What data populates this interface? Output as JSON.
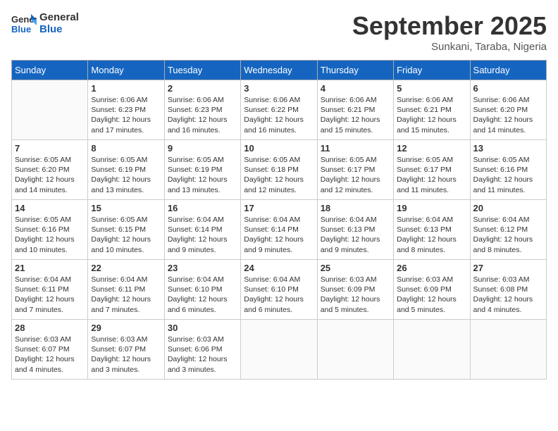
{
  "header": {
    "logo_line1": "General",
    "logo_line2": "Blue",
    "month": "September 2025",
    "location": "Sunkani, Taraba, Nigeria"
  },
  "days_of_week": [
    "Sunday",
    "Monday",
    "Tuesday",
    "Wednesday",
    "Thursday",
    "Friday",
    "Saturday"
  ],
  "weeks": [
    [
      {
        "day": "",
        "sunrise": "",
        "sunset": "",
        "daylight": ""
      },
      {
        "day": "1",
        "sunrise": "Sunrise: 6:06 AM",
        "sunset": "Sunset: 6:23 PM",
        "daylight": "Daylight: 12 hours and 17 minutes."
      },
      {
        "day": "2",
        "sunrise": "Sunrise: 6:06 AM",
        "sunset": "Sunset: 6:23 PM",
        "daylight": "Daylight: 12 hours and 16 minutes."
      },
      {
        "day": "3",
        "sunrise": "Sunrise: 6:06 AM",
        "sunset": "Sunset: 6:22 PM",
        "daylight": "Daylight: 12 hours and 16 minutes."
      },
      {
        "day": "4",
        "sunrise": "Sunrise: 6:06 AM",
        "sunset": "Sunset: 6:21 PM",
        "daylight": "Daylight: 12 hours and 15 minutes."
      },
      {
        "day": "5",
        "sunrise": "Sunrise: 6:06 AM",
        "sunset": "Sunset: 6:21 PM",
        "daylight": "Daylight: 12 hours and 15 minutes."
      },
      {
        "day": "6",
        "sunrise": "Sunrise: 6:06 AM",
        "sunset": "Sunset: 6:20 PM",
        "daylight": "Daylight: 12 hours and 14 minutes."
      }
    ],
    [
      {
        "day": "7",
        "sunrise": "Sunrise: 6:05 AM",
        "sunset": "Sunset: 6:20 PM",
        "daylight": "Daylight: 12 hours and 14 minutes."
      },
      {
        "day": "8",
        "sunrise": "Sunrise: 6:05 AM",
        "sunset": "Sunset: 6:19 PM",
        "daylight": "Daylight: 12 hours and 13 minutes."
      },
      {
        "day": "9",
        "sunrise": "Sunrise: 6:05 AM",
        "sunset": "Sunset: 6:19 PM",
        "daylight": "Daylight: 12 hours and 13 minutes."
      },
      {
        "day": "10",
        "sunrise": "Sunrise: 6:05 AM",
        "sunset": "Sunset: 6:18 PM",
        "daylight": "Daylight: 12 hours and 12 minutes."
      },
      {
        "day": "11",
        "sunrise": "Sunrise: 6:05 AM",
        "sunset": "Sunset: 6:17 PM",
        "daylight": "Daylight: 12 hours and 12 minutes."
      },
      {
        "day": "12",
        "sunrise": "Sunrise: 6:05 AM",
        "sunset": "Sunset: 6:17 PM",
        "daylight": "Daylight: 12 hours and 11 minutes."
      },
      {
        "day": "13",
        "sunrise": "Sunrise: 6:05 AM",
        "sunset": "Sunset: 6:16 PM",
        "daylight": "Daylight: 12 hours and 11 minutes."
      }
    ],
    [
      {
        "day": "14",
        "sunrise": "Sunrise: 6:05 AM",
        "sunset": "Sunset: 6:16 PM",
        "daylight": "Daylight: 12 hours and 10 minutes."
      },
      {
        "day": "15",
        "sunrise": "Sunrise: 6:05 AM",
        "sunset": "Sunset: 6:15 PM",
        "daylight": "Daylight: 12 hours and 10 minutes."
      },
      {
        "day": "16",
        "sunrise": "Sunrise: 6:04 AM",
        "sunset": "Sunset: 6:14 PM",
        "daylight": "Daylight: 12 hours and 9 minutes."
      },
      {
        "day": "17",
        "sunrise": "Sunrise: 6:04 AM",
        "sunset": "Sunset: 6:14 PM",
        "daylight": "Daylight: 12 hours and 9 minutes."
      },
      {
        "day": "18",
        "sunrise": "Sunrise: 6:04 AM",
        "sunset": "Sunset: 6:13 PM",
        "daylight": "Daylight: 12 hours and 9 minutes."
      },
      {
        "day": "19",
        "sunrise": "Sunrise: 6:04 AM",
        "sunset": "Sunset: 6:13 PM",
        "daylight": "Daylight: 12 hours and 8 minutes."
      },
      {
        "day": "20",
        "sunrise": "Sunrise: 6:04 AM",
        "sunset": "Sunset: 6:12 PM",
        "daylight": "Daylight: 12 hours and 8 minutes."
      }
    ],
    [
      {
        "day": "21",
        "sunrise": "Sunrise: 6:04 AM",
        "sunset": "Sunset: 6:11 PM",
        "daylight": "Daylight: 12 hours and 7 minutes."
      },
      {
        "day": "22",
        "sunrise": "Sunrise: 6:04 AM",
        "sunset": "Sunset: 6:11 PM",
        "daylight": "Daylight: 12 hours and 7 minutes."
      },
      {
        "day": "23",
        "sunrise": "Sunrise: 6:04 AM",
        "sunset": "Sunset: 6:10 PM",
        "daylight": "Daylight: 12 hours and 6 minutes."
      },
      {
        "day": "24",
        "sunrise": "Sunrise: 6:04 AM",
        "sunset": "Sunset: 6:10 PM",
        "daylight": "Daylight: 12 hours and 6 minutes."
      },
      {
        "day": "25",
        "sunrise": "Sunrise: 6:03 AM",
        "sunset": "Sunset: 6:09 PM",
        "daylight": "Daylight: 12 hours and 5 minutes."
      },
      {
        "day": "26",
        "sunrise": "Sunrise: 6:03 AM",
        "sunset": "Sunset: 6:09 PM",
        "daylight": "Daylight: 12 hours and 5 minutes."
      },
      {
        "day": "27",
        "sunrise": "Sunrise: 6:03 AM",
        "sunset": "Sunset: 6:08 PM",
        "daylight": "Daylight: 12 hours and 4 minutes."
      }
    ],
    [
      {
        "day": "28",
        "sunrise": "Sunrise: 6:03 AM",
        "sunset": "Sunset: 6:07 PM",
        "daylight": "Daylight: 12 hours and 4 minutes."
      },
      {
        "day": "29",
        "sunrise": "Sunrise: 6:03 AM",
        "sunset": "Sunset: 6:07 PM",
        "daylight": "Daylight: 12 hours and 3 minutes."
      },
      {
        "day": "30",
        "sunrise": "Sunrise: 6:03 AM",
        "sunset": "Sunset: 6:06 PM",
        "daylight": "Daylight: 12 hours and 3 minutes."
      },
      {
        "day": "",
        "sunrise": "",
        "sunset": "",
        "daylight": ""
      },
      {
        "day": "",
        "sunrise": "",
        "sunset": "",
        "daylight": ""
      },
      {
        "day": "",
        "sunrise": "",
        "sunset": "",
        "daylight": ""
      },
      {
        "day": "",
        "sunrise": "",
        "sunset": "",
        "daylight": ""
      }
    ]
  ]
}
